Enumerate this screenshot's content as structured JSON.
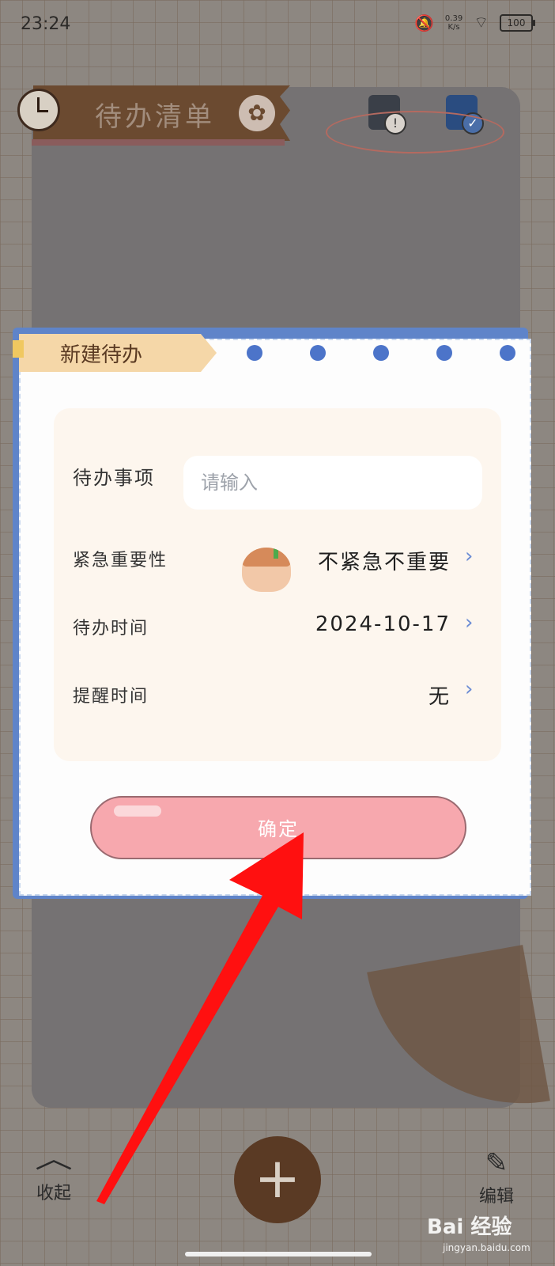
{
  "status_bar": {
    "time": "23:24",
    "net_speed_value": "0.39",
    "net_speed_unit": "K/s",
    "battery": "100"
  },
  "header": {
    "title": "待办清单",
    "icons": [
      "clock-icon",
      "paw-icon",
      "pending-list-icon",
      "done-list-icon"
    ]
  },
  "dialog": {
    "title": "新建待办",
    "fields": {
      "item": {
        "label": "待办事项",
        "placeholder": "请输入",
        "value": ""
      },
      "priority": {
        "label": "紧急重要性",
        "value": "不紧急不重要"
      },
      "date": {
        "label": "待办时间",
        "value": "2024-10-17"
      },
      "reminder": {
        "label": "提醒时间",
        "value": "无"
      }
    },
    "confirm_label": "确定"
  },
  "bottom_bar": {
    "collapse_label": "收起",
    "add_symbol": "+",
    "edit_label": "编辑"
  },
  "watermark": {
    "brand": "Bai 经验",
    "url": "jingyan.baidu.com"
  },
  "colors": {
    "accent_pink": "#f7a8ae",
    "dialog_blue": "#5f84c9",
    "brown": "#5a3a24",
    "arrow_red": "#ff0000"
  }
}
